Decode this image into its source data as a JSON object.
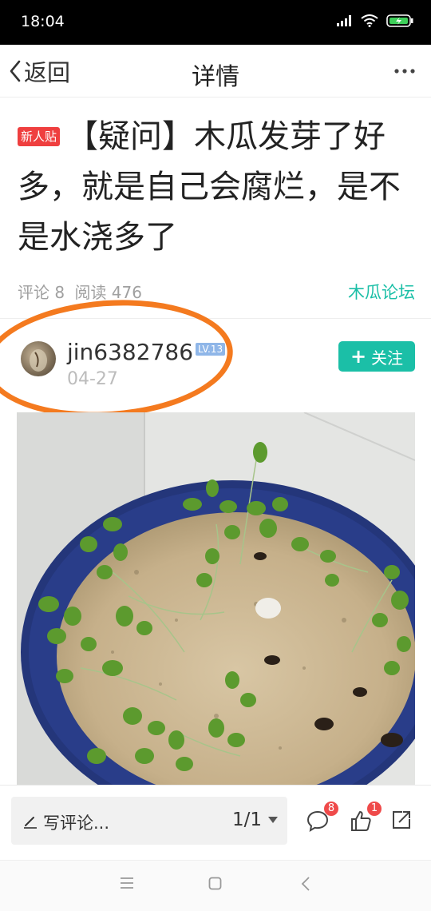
{
  "status_bar": {
    "time": "18:04"
  },
  "nav": {
    "back_label": "返回",
    "title": "详情"
  },
  "post": {
    "badge": "新人贴",
    "title": "【疑问】木瓜发芽了好多，就是自己会腐烂，是不是水浇多了",
    "comment_count_text": "评论 8",
    "read_count_text": "阅读 476",
    "forum": "木瓜论坛"
  },
  "author": {
    "name": "jin6382786",
    "level": "LV.13",
    "date": "04-27",
    "follow_label": "关注"
  },
  "bottom_bar": {
    "comment_placeholder": "写评论...",
    "page_indicator": "1/1",
    "comments_badge": "8",
    "likes_badge": "1"
  },
  "colors": {
    "accent": "#1bbfa7",
    "badge_red": "#ef3f3f",
    "annotation_orange": "#f47a1f"
  },
  "icons": [
    "chevron-left-icon",
    "more-icon",
    "plus-icon",
    "pen-icon",
    "caret-down-icon",
    "comment-icon",
    "thumbs-up-icon",
    "share-icon",
    "menu-icon",
    "home-icon",
    "back-icon",
    "signal-icon",
    "wifi-icon",
    "battery-icon"
  ]
}
